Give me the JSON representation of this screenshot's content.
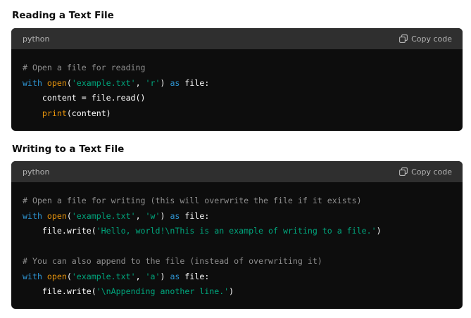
{
  "sections": [
    {
      "heading": "Reading a Text File",
      "language": "python",
      "copy_label": "Copy code",
      "lines": [
        [
          {
            "t": "# Open a file for reading",
            "c": "comment"
          }
        ],
        [
          {
            "t": "with",
            "c": "keyword"
          },
          {
            "t": " ",
            "c": "plain"
          },
          {
            "t": "open",
            "c": "builtin"
          },
          {
            "t": "(",
            "c": "plain"
          },
          {
            "t": "'example.txt'",
            "c": "string"
          },
          {
            "t": ", ",
            "c": "plain"
          },
          {
            "t": "'r'",
            "c": "string"
          },
          {
            "t": ") ",
            "c": "plain"
          },
          {
            "t": "as",
            "c": "keyword"
          },
          {
            "t": " file:",
            "c": "plain"
          }
        ],
        [
          {
            "t": "    content = file.read()",
            "c": "plain"
          }
        ],
        [
          {
            "t": "    ",
            "c": "plain"
          },
          {
            "t": "print",
            "c": "builtin"
          },
          {
            "t": "(content)",
            "c": "plain"
          }
        ]
      ]
    },
    {
      "heading": "Writing to a Text File",
      "language": "python",
      "copy_label": "Copy code",
      "lines": [
        [
          {
            "t": "# Open a file for writing (this will overwrite the file if it exists)",
            "c": "comment"
          }
        ],
        [
          {
            "t": "with",
            "c": "keyword"
          },
          {
            "t": " ",
            "c": "plain"
          },
          {
            "t": "open",
            "c": "builtin"
          },
          {
            "t": "(",
            "c": "plain"
          },
          {
            "t": "'example.txt'",
            "c": "string"
          },
          {
            "t": ", ",
            "c": "plain"
          },
          {
            "t": "'w'",
            "c": "string"
          },
          {
            "t": ") ",
            "c": "plain"
          },
          {
            "t": "as",
            "c": "keyword"
          },
          {
            "t": " file:",
            "c": "plain"
          }
        ],
        [
          {
            "t": "    file.write(",
            "c": "plain"
          },
          {
            "t": "'Hello, world!\\nThis is an example of writing to a file.'",
            "c": "string"
          },
          {
            "t": ")",
            "c": "plain"
          }
        ],
        [],
        [
          {
            "t": "# You can also append to the file (instead of overwriting it)",
            "c": "comment"
          }
        ],
        [
          {
            "t": "with",
            "c": "keyword"
          },
          {
            "t": " ",
            "c": "plain"
          },
          {
            "t": "open",
            "c": "builtin"
          },
          {
            "t": "(",
            "c": "plain"
          },
          {
            "t": "'example.txt'",
            "c": "string"
          },
          {
            "t": ", ",
            "c": "plain"
          },
          {
            "t": "'a'",
            "c": "string"
          },
          {
            "t": ") ",
            "c": "plain"
          },
          {
            "t": "as",
            "c": "keyword"
          },
          {
            "t": " file:",
            "c": "plain"
          }
        ],
        [
          {
            "t": "    file.write(",
            "c": "plain"
          },
          {
            "t": "'\\nAppending another line.'",
            "c": "string"
          },
          {
            "t": ")",
            "c": "plain"
          }
        ]
      ]
    }
  ],
  "icons": {
    "copy": "copy-icon"
  },
  "colors": {
    "header_bg": "#2f2f2f",
    "code_bg": "#0d0d0d",
    "comment": "#8e8e8e",
    "keyword": "#2e95d3",
    "builtin": "#e9950c",
    "string": "#00a67d",
    "plain": "#ffffff"
  }
}
